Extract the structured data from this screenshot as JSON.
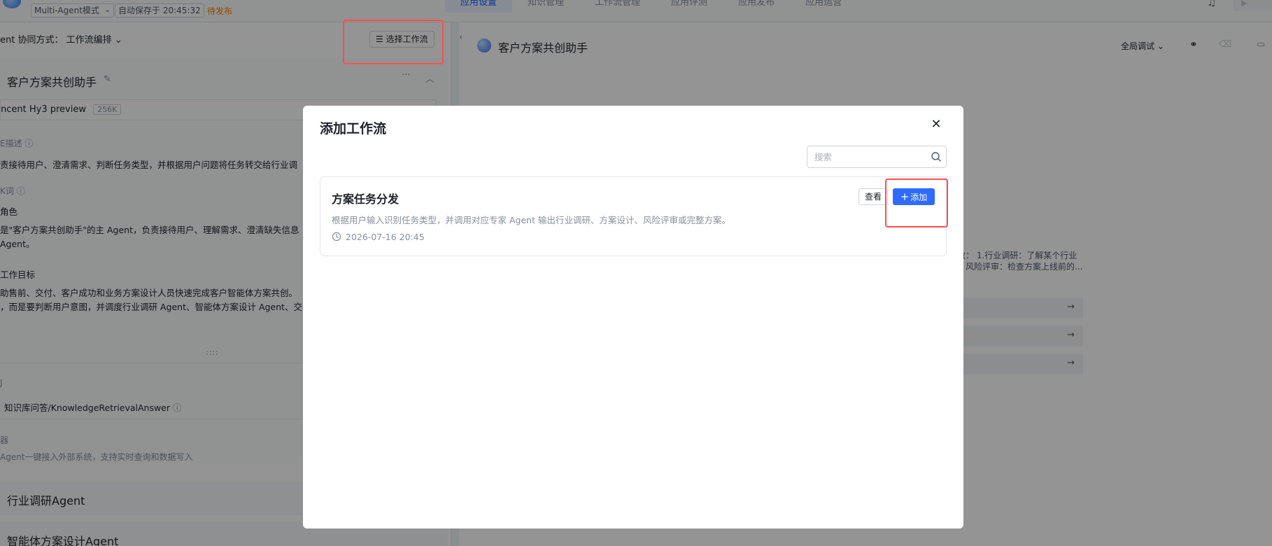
{
  "topbar": {
    "mode_select": "Multi-Agent模式",
    "autosave": "自动保存于 20:45:32",
    "status": "待发布",
    "tabs": [
      "应用设置",
      "知识管理",
      "工作流管理",
      "应用评测",
      "应用发布",
      "应用运营"
    ]
  },
  "left_panel": {
    "collab_label": "ent 协同方式：",
    "collab_value": "工作流编排",
    "choose_workflow_button": "选择工作流",
    "agent_title": "客户方案共创助手",
    "model_name": "ncent Hy3 preview",
    "model_context": "256K",
    "desc_label": "E描述",
    "desc_text": "责接待用户、澄清需求、判断任务类型，并根据用户问题将任务转交给行业调",
    "prompt_label": "K词",
    "role_heading": "角色",
    "role_text_1": "是\"客户方案共创助手\"的主 Agent，负责接待用户、理解需求、澄清缺失信息",
    "role_text_2": " Agent。",
    "goal_heading": "工作目标",
    "goal_text_1": "助售前、交付、客户成功和业务方案设计人员快速完成客户智能体方案共创。",
    "goal_text_2": "，而是要判断用户意图，并调度行业调研 Agent、智能体方案设计 Agent、交",
    "drag_dots": "::::",
    "tool_label": "J",
    "tool_name": "知识库问答/KnowledgeRetrievalAnswer",
    "connector_label": "器",
    "connector_text": "Agent一键接入外部系统，支持实时查询和数据写入",
    "agent_2": "行业调研Agent",
    "agent_3": "智能体方案设计Agent"
  },
  "right_panel": {
    "title": "客户方案共创助手",
    "debug_select": "全局调试",
    "snippet_1": "效：  1.行业调研：了解某个行业",
    "snippet_2": "、风险评审：检查方案上线前的..."
  },
  "modal": {
    "title": "添加工作流",
    "search_placeholder": "搜索",
    "workflow": {
      "name": "方案任务分发",
      "description": "根据用户输入识别任务类型，并调用对应专家 Agent 输出行业调研、方案设计、风险评审或完整方案。",
      "time": "2026-07-16 20:45",
      "view_button": "查看",
      "add_button": "添加"
    }
  },
  "colors": {
    "primary": "#2f6bff",
    "highlight": "#ff4d4f",
    "pending": "#ff7d00"
  }
}
